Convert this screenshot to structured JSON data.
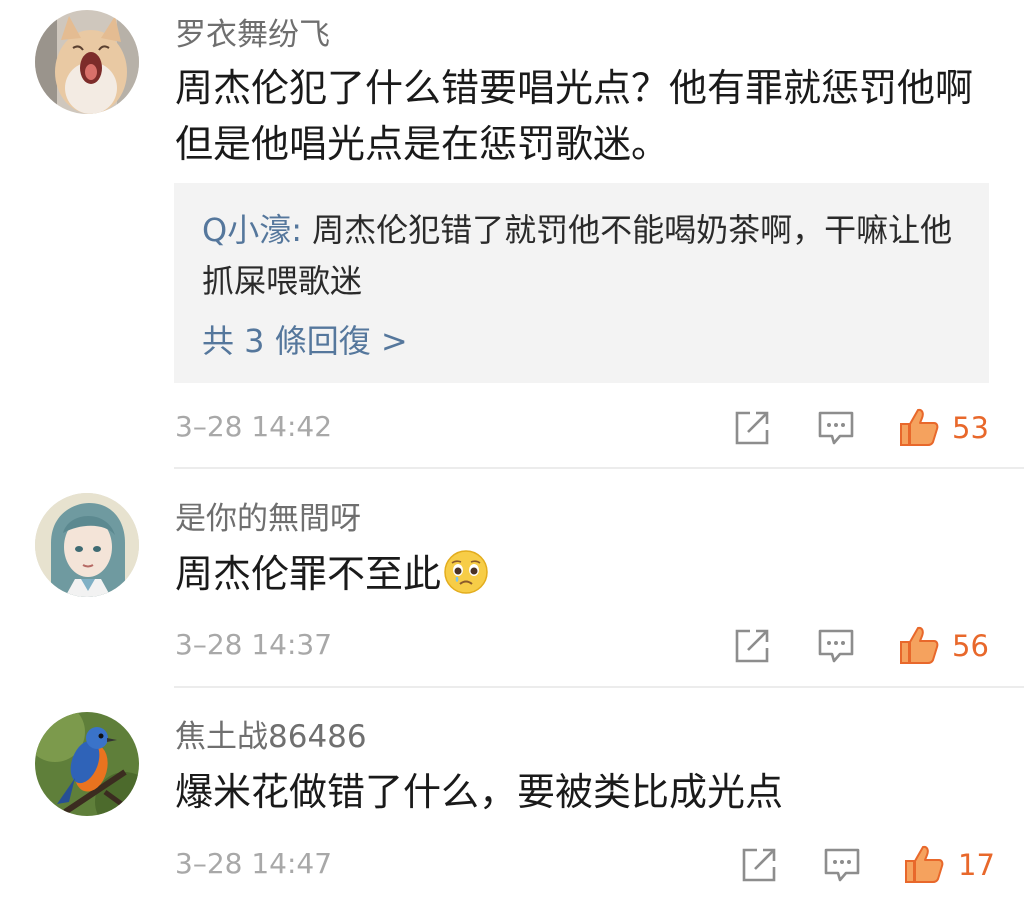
{
  "comments": [
    {
      "username": "罗衣舞纷飞",
      "text": "周杰伦犯了什么错要唱光点？他有罪就惩罚他啊但是他唱光点是在惩罚歌迷。",
      "reply": {
        "author": "Q小濠:",
        "text": " 周杰伦犯错了就罚他不能喝奶茶啊，干嘛让他抓屎喂歌迷",
        "more": "共 3 條回復 >"
      },
      "timestamp": "3–28 14:42",
      "likes": "53",
      "avatar_icon": "cat-avatar-icon"
    },
    {
      "username": "是你的無間呀",
      "text": "周杰伦罪不至此",
      "emoji_icon": "pleading-face-icon",
      "timestamp": "3–28 14:37",
      "likes": "56",
      "avatar_icon": "anime-character-avatar-icon"
    },
    {
      "username": "焦土战86486",
      "text": "爆米花做错了什么，要被类比成光点",
      "timestamp": "3–28 14:47",
      "likes": "17",
      "avatar_icon": "bird-avatar-icon"
    }
  ],
  "icons": {
    "share": "share-icon",
    "comment": "comment-icon",
    "like": "thumbs-up-icon"
  },
  "colors": {
    "like_orange": "#e8682b",
    "reply_link_blue": "#55779c",
    "reply_bg": "#f3f3f3",
    "meta_gray": "#a8a8a8"
  }
}
